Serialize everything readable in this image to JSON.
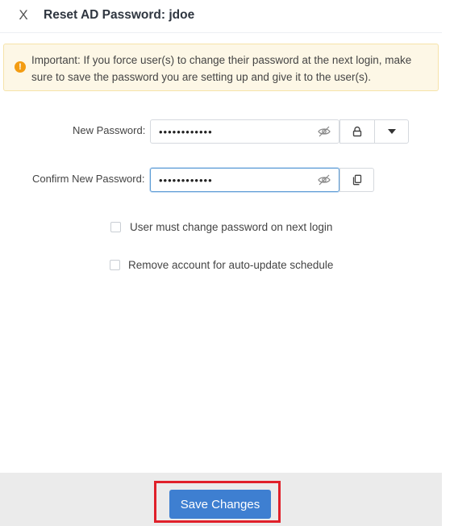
{
  "dialog": {
    "close_label": "X",
    "title": "Reset AD Password: jdoe"
  },
  "notice": {
    "icon": "exclamation-icon",
    "icon_glyph": "!",
    "text": "Important: If you force user(s) to change their password at the next login, make sure to save the password you are setting up and give it to the user(s)."
  },
  "form": {
    "new_password": {
      "label": "New Password",
      "value": "••••••••••••"
    },
    "confirm_password": {
      "label": "Confirm New Password",
      "value": "••••••••••••"
    },
    "options": [
      {
        "label": "User must change password on next login",
        "checked": false
      },
      {
        "label": "Remove account for auto-update schedule",
        "checked": false
      }
    ]
  },
  "footer": {
    "save_label": "Save Changes"
  },
  "colors": {
    "primary": "#3e7fd1",
    "highlight": "#e0202a",
    "notice_bg": "#fdf7e6",
    "notice_icon": "#f39c12"
  }
}
